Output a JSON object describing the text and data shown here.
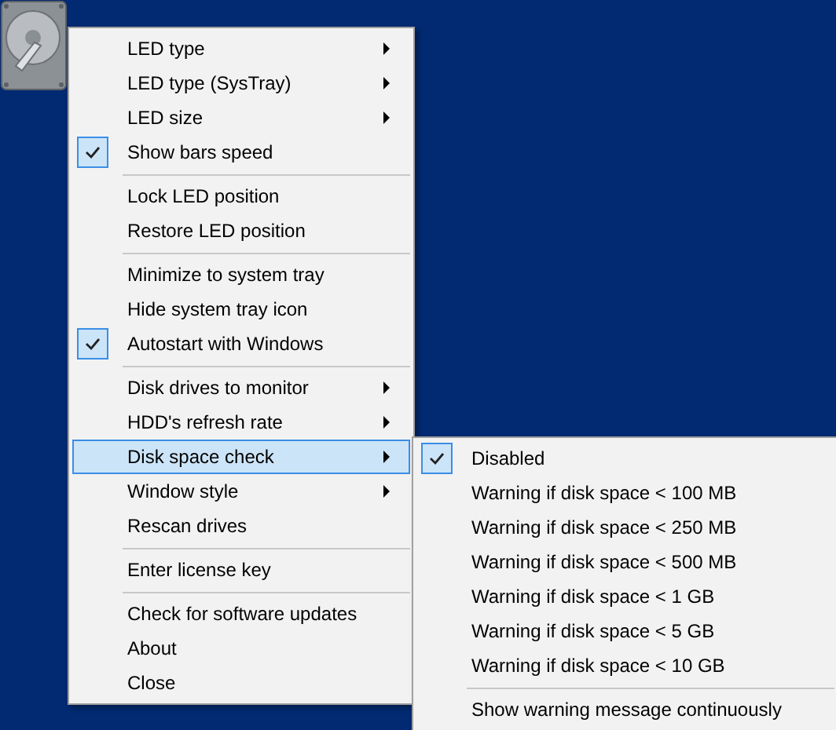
{
  "menu": {
    "items": [
      {
        "kind": "item",
        "label": "LED type",
        "checked": false,
        "submenu": true,
        "selected": false
      },
      {
        "kind": "item",
        "label": "LED type (SysTray)",
        "checked": false,
        "submenu": true,
        "selected": false
      },
      {
        "kind": "item",
        "label": "LED size",
        "checked": false,
        "submenu": true,
        "selected": false
      },
      {
        "kind": "item",
        "label": "Show bars speed",
        "checked": true,
        "submenu": false,
        "selected": false
      },
      {
        "kind": "separator"
      },
      {
        "kind": "item",
        "label": "Lock LED position",
        "checked": false,
        "submenu": false,
        "selected": false
      },
      {
        "kind": "item",
        "label": "Restore LED position",
        "checked": false,
        "submenu": false,
        "selected": false
      },
      {
        "kind": "separator"
      },
      {
        "kind": "item",
        "label": "Minimize to system tray",
        "checked": false,
        "submenu": false,
        "selected": false
      },
      {
        "kind": "item",
        "label": "Hide system tray icon",
        "checked": false,
        "submenu": false,
        "selected": false
      },
      {
        "kind": "item",
        "label": "Autostart with Windows",
        "checked": true,
        "submenu": false,
        "selected": false
      },
      {
        "kind": "separator"
      },
      {
        "kind": "item",
        "label": "Disk drives to monitor",
        "checked": false,
        "submenu": true,
        "selected": false
      },
      {
        "kind": "item",
        "label": "HDD's refresh rate",
        "checked": false,
        "submenu": true,
        "selected": false
      },
      {
        "kind": "item",
        "label": "Disk space check",
        "checked": false,
        "submenu": true,
        "selected": true
      },
      {
        "kind": "item",
        "label": "Window style",
        "checked": false,
        "submenu": true,
        "selected": false
      },
      {
        "kind": "item",
        "label": "Rescan drives",
        "checked": false,
        "submenu": false,
        "selected": false
      },
      {
        "kind": "separator"
      },
      {
        "kind": "item",
        "label": "Enter license key",
        "checked": false,
        "submenu": false,
        "selected": false
      },
      {
        "kind": "separator"
      },
      {
        "kind": "item",
        "label": "Check for software updates",
        "checked": false,
        "submenu": false,
        "selected": false
      },
      {
        "kind": "item",
        "label": "About",
        "checked": false,
        "submenu": false,
        "selected": false
      },
      {
        "kind": "item",
        "label": "Close",
        "checked": false,
        "submenu": false,
        "selected": false
      }
    ]
  },
  "submenu": {
    "items": [
      {
        "kind": "item",
        "label": "Disabled",
        "checked": true
      },
      {
        "kind": "item",
        "label": "Warning if disk space < 100 MB",
        "checked": false
      },
      {
        "kind": "item",
        "label": "Warning if disk space < 250 MB",
        "checked": false
      },
      {
        "kind": "item",
        "label": "Warning if disk space < 500 MB",
        "checked": false
      },
      {
        "kind": "item",
        "label": "Warning if disk space < 1 GB",
        "checked": false
      },
      {
        "kind": "item",
        "label": "Warning if disk space < 5 GB",
        "checked": false
      },
      {
        "kind": "item",
        "label": "Warning if disk space < 10 GB",
        "checked": false
      },
      {
        "kind": "separator"
      },
      {
        "kind": "item",
        "label": "Show warning message continuously",
        "checked": false
      }
    ]
  }
}
